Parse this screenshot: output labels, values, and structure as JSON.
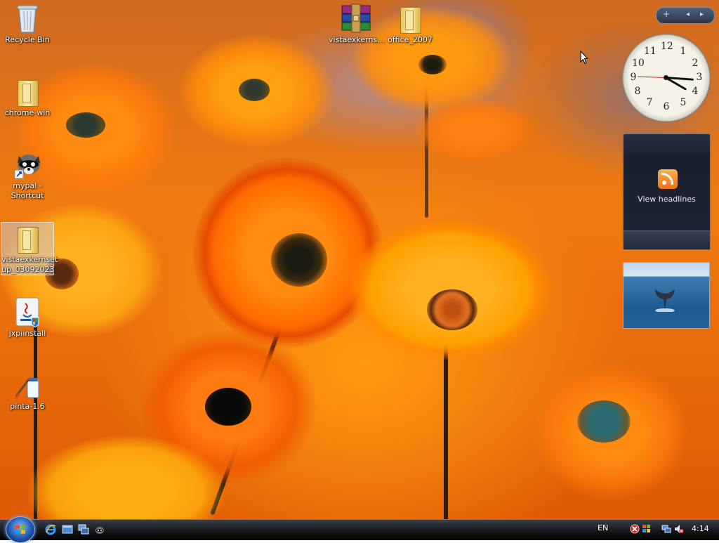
{
  "desktop_icons": [
    {
      "id": "recycle-bin",
      "label": "Recycle Bin"
    },
    {
      "id": "chrome-win",
      "label": "chrome-win"
    },
    {
      "id": "mypal",
      "label": "mypal - Shortcut"
    },
    {
      "id": "vistaexkernsetup",
      "label": "vistaexkernset up_03092023"
    },
    {
      "id": "jxpiinstall",
      "label": "jxpiinstall"
    },
    {
      "id": "pinta",
      "label": "pinta-1.6"
    },
    {
      "id": "vistaexkerns-rar",
      "label": "vistaexkerns..."
    },
    {
      "id": "office-2007",
      "label": "office_2007"
    }
  ],
  "sidebar": {
    "controls": {
      "add": "+",
      "prev": "◂",
      "next": "▸"
    },
    "clock": {
      "numbers": [
        "12",
        "1",
        "2",
        "3",
        "4",
        "5",
        "6",
        "7",
        "8",
        "9",
        "10",
        "11"
      ],
      "time_shown": "3:20"
    },
    "feed_headlines": {
      "label": "View headlines"
    },
    "slideshow": {
      "subject": "whale tail over ocean"
    }
  },
  "taskbar": {
    "quick_launch": [
      "internet-explorer-icon",
      "show-desktop-icon",
      "switch-windows-icon",
      "mypal-icon"
    ],
    "language": "EN",
    "tray_icons": [
      "security-alert-icon",
      "windows-update-icon",
      "network-icon",
      "volume-muted-icon"
    ],
    "clock": "4:14"
  },
  "colors": {
    "accent": "#f07a10",
    "taskbar": "#14161a"
  }
}
